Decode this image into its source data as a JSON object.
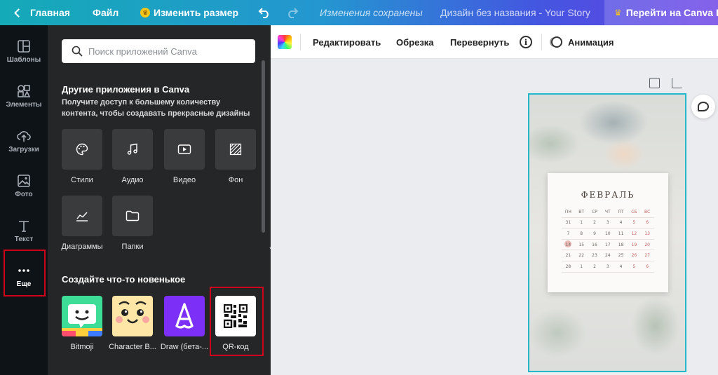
{
  "topbar": {
    "home": "Главная",
    "file": "Файл",
    "resize": "Изменить размер",
    "saved_status": "Изменения сохранены",
    "doc_title": "Дизайн без названия - Your Story",
    "upgrade": "Перейти на Canva Pro"
  },
  "rail": {
    "items": [
      {
        "label": "Шаблоны",
        "icon": "templates-icon"
      },
      {
        "label": "Элементы",
        "icon": "elements-icon"
      },
      {
        "label": "Загрузки",
        "icon": "uploads-icon"
      },
      {
        "label": "Фото",
        "icon": "photo-icon"
      },
      {
        "label": "Текст",
        "icon": "text-icon"
      },
      {
        "label": "Еще",
        "icon": "more-icon"
      }
    ]
  },
  "panel": {
    "search_placeholder": "Поиск приложений Canva",
    "other_apps_title": "Другие приложения в Canva",
    "other_apps_sub": "Получите доступ к большему количеству контента, чтобы создавать прекрасные дизайны",
    "apps": [
      {
        "label": "Стили",
        "icon": "palette-icon"
      },
      {
        "label": "Аудио",
        "icon": "music-icon"
      },
      {
        "label": "Видео",
        "icon": "video-icon"
      },
      {
        "label": "Фон",
        "icon": "pattern-icon"
      },
      {
        "label": "Диаграммы",
        "icon": "chart-icon"
      },
      {
        "label": "Папки",
        "icon": "folder-icon"
      }
    ],
    "create_title": "Создайте что-то новенькое",
    "create_apps": [
      {
        "label": "Bitmoji",
        "color": "#3ddc97"
      },
      {
        "label": "Character B...",
        "color": "#fde6a6"
      },
      {
        "label": "Draw (бета-...",
        "color": "#7b2ff7"
      },
      {
        "label": "QR-код",
        "color": "#ffffff"
      }
    ]
  },
  "editor": {
    "edit": "Редактировать",
    "crop": "Обрезка",
    "flip": "Перевернуть",
    "info": "i",
    "animate": "Анимация"
  },
  "calendar": {
    "month": "ФЕВРАЛЬ",
    "weekdays": [
      "ПН",
      "ВТ",
      "СР",
      "ЧТ",
      "ПТ",
      "СБ",
      "ВС"
    ],
    "weeks": [
      [
        "31",
        "1",
        "2",
        "3",
        "4",
        "5",
        "6"
      ],
      [
        "7",
        "8",
        "9",
        "10",
        "11",
        "12",
        "13"
      ],
      [
        "14",
        "15",
        "16",
        "17",
        "18",
        "19",
        "20"
      ],
      [
        "21",
        "22",
        "23",
        "24",
        "25",
        "26",
        "27"
      ],
      [
        "28",
        "1",
        "2",
        "3",
        "4",
        "5",
        "6"
      ]
    ],
    "marked_day": "14"
  },
  "colors": {
    "accent": "#22b8c9",
    "highlight": "#d0021b",
    "panel_bg": "#252627",
    "rail_bg": "#0e1318"
  }
}
